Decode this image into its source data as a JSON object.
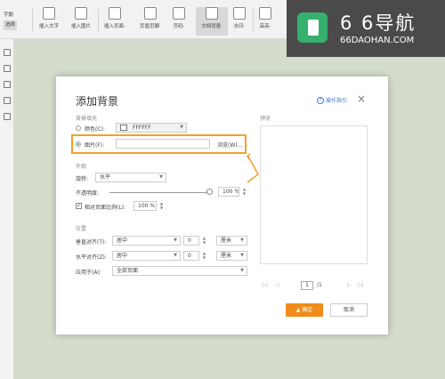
{
  "toolbar": {
    "hand_label": "手動",
    "select_label": "选择",
    "items": [
      {
        "label": "插入文字"
      },
      {
        "label": "插入图片"
      },
      {
        "label": "插入页面·"
      },
      {
        "label": "页眉页脚·"
      },
      {
        "label": "页码·"
      },
      {
        "label": "文档背景·"
      },
      {
        "label": "水印·"
      },
      {
        "label": "高亮·"
      }
    ]
  },
  "logo": {
    "name": "6 6导航",
    "domain": "66DAOHAN.COM"
  },
  "dialog": {
    "title": "添加背景",
    "help_label": "操作指引",
    "close_label": "×",
    "fill_section": "背景填充",
    "color_label": "颜色(C):",
    "color_value": "FFFFFF",
    "picture_label": "图片(F):",
    "picture_value": "",
    "browse_label": "浏览(W)...",
    "appearance_section": "外观",
    "rotation_label": "旋转:",
    "rotation_value": "水平",
    "opacity_label": "不透明度:",
    "opacity_value": "100 %",
    "opacity_fraction": 1.0,
    "scale_label": "相对页面比例(L):",
    "scale_value": "100 %",
    "position_section": "位置",
    "v_align_label": "垂直对齐(T):",
    "v_align_value": "居中",
    "v_offset": "0",
    "v_unit": "厘米",
    "h_align_label": "水平对齐(Z):",
    "h_align_value": "居中",
    "h_offset": "0",
    "h_unit": "厘米",
    "apply_label": "应用于(A):",
    "apply_value": "全部页面",
    "preview_label": "预览",
    "page_current": "1",
    "page_total": "/1",
    "ok_label": "确定",
    "cancel_label": "取消"
  },
  "colors": {
    "accent": "#f08c1a",
    "highlight": "#f0a030",
    "logo_bg": "#4a4a4a",
    "logo_mark": "#35b06f"
  }
}
